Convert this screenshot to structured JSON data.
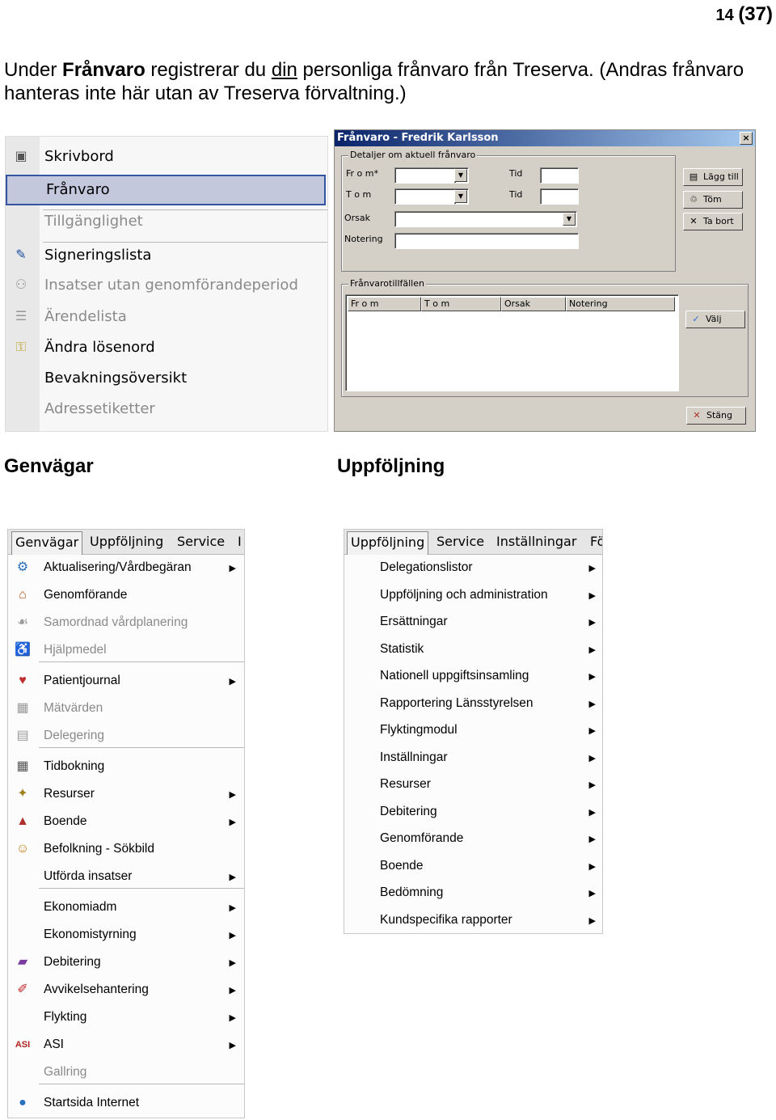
{
  "page": {
    "number": "14",
    "total": "(37)"
  },
  "intro": {
    "part1": "Under ",
    "bold": "Frånvaro",
    "part2": " registrerar du ",
    "underlined": "din",
    "part3": " personliga frånvaro från Treserva. (Andras frånvaro hanteras inte här utan av Treserva förvaltning.)"
  },
  "shortcut_menu": {
    "items": [
      {
        "label": "Skrivbord",
        "icon": "desktop-icon",
        "disabled": false
      },
      {
        "label": "Frånvaro",
        "icon": "",
        "disabled": false,
        "selected": true
      },
      {
        "label": "Tillgänglighet",
        "icon": "",
        "disabled": true
      },
      {
        "label": "Signeringslista",
        "icon": "signing-icon",
        "disabled": false
      },
      {
        "label": "Insatser utan genomförandeperiod",
        "icon": "people-icon",
        "disabled": true
      },
      {
        "label": "Ärendelista",
        "icon": "list-icon",
        "disabled": true
      },
      {
        "label": "Ändra lösenord",
        "icon": "key-icon",
        "disabled": false
      },
      {
        "label": "Bevakningsöversikt",
        "icon": "",
        "disabled": false
      },
      {
        "label": "Adressetiketter",
        "icon": "",
        "disabled": true
      }
    ]
  },
  "dialog": {
    "title": "Frånvaro - Fredrik Karlsson",
    "close": "×",
    "details_group": "Detaljer om aktuell frånvaro",
    "from_label": "Fr o m*",
    "tom_label": "T o m",
    "tid_label": "Tid",
    "orsak_label": "Orsak",
    "notering_label": "Notering",
    "add_button": "Lägg till",
    "clear_button": "Töm",
    "delete_button": "Ta bort",
    "occasions_group": "Frånvarotillfällen",
    "columns": [
      "Fr o m",
      "T o m",
      "Orsak",
      "Notering"
    ],
    "select_button": "Välj",
    "close_button": "Stäng"
  },
  "captions": {
    "left": "Genvägar",
    "right": "Uppföljning"
  },
  "genvagar_menubar": [
    "Genvägar",
    "Uppföljning",
    "Service",
    "I"
  ],
  "genvagar_menu": {
    "items": [
      {
        "label": "Aktualisering/Vårdbegäran",
        "icon": "gear-icon",
        "submenu": true,
        "disabled": false
      },
      {
        "label": "Genomförande",
        "icon": "house-icon",
        "submenu": false,
        "disabled": false
      },
      {
        "label": "Samordnad vårdplanering",
        "icon": "handshake-icon",
        "submenu": false,
        "disabled": true
      },
      {
        "label": "Hjälpmedel",
        "icon": "wheelchair-icon",
        "submenu": false,
        "disabled": true
      },
      {
        "label": "Patientjournal",
        "icon": "heart-icon",
        "submenu": true,
        "disabled": false
      },
      {
        "label": "Mätvärden",
        "icon": "chart-icon",
        "submenu": false,
        "disabled": true
      },
      {
        "label": "Delegering",
        "icon": "document-icon",
        "submenu": false,
        "disabled": true
      },
      {
        "label": "Tidbokning",
        "icon": "calendar-icon",
        "submenu": false,
        "disabled": false
      },
      {
        "label": "Resurser",
        "icon": "wand-icon",
        "submenu": true,
        "disabled": false
      },
      {
        "label": "Boende",
        "icon": "building-icon",
        "submenu": true,
        "disabled": false
      },
      {
        "label": "Befolkning - Sökbild",
        "icon": "crowd-icon",
        "submenu": false,
        "disabled": false
      },
      {
        "label": "Utförda insatser",
        "icon": "",
        "submenu": true,
        "disabled": false
      },
      {
        "label": "Ekonomiadm",
        "icon": "",
        "submenu": true,
        "disabled": false
      },
      {
        "label": "Ekonomistyrning",
        "icon": "",
        "submenu": true,
        "disabled": false
      },
      {
        "label": "Debitering",
        "icon": "book-icon",
        "submenu": true,
        "disabled": false
      },
      {
        "label": "Avvikelsehantering",
        "icon": "pen-icon",
        "submenu": true,
        "disabled": false
      },
      {
        "label": "Flykting",
        "icon": "",
        "submenu": true,
        "disabled": false
      },
      {
        "label": "ASI",
        "icon": "asi-icon",
        "icon_text": "ASI",
        "submenu": true,
        "disabled": false
      },
      {
        "label": "Gallring",
        "icon": "",
        "submenu": false,
        "disabled": true
      },
      {
        "label": "Startsida Internet",
        "icon": "globe-icon",
        "submenu": false,
        "disabled": false
      }
    ]
  },
  "uppfoljning_menubar": [
    "Uppföljning",
    "Service",
    "Inställningar",
    "Fö"
  ],
  "uppfoljning_menu": {
    "items": [
      {
        "label": "Delegationslistor",
        "submenu": true
      },
      {
        "label": "Uppföljning och administration",
        "submenu": true
      },
      {
        "label": "Ersättningar",
        "submenu": true
      },
      {
        "label": "Statistik",
        "submenu": true
      },
      {
        "label": "Nationell uppgiftsinsamling",
        "submenu": true
      },
      {
        "label": "Rapportering Länsstyrelsen",
        "submenu": true
      },
      {
        "label": "Flyktingmodul",
        "submenu": true
      },
      {
        "label": "Inställningar",
        "submenu": true
      },
      {
        "label": "Resurser",
        "submenu": true
      },
      {
        "label": "Debitering",
        "submenu": true
      },
      {
        "label": "Genomförande",
        "submenu": true
      },
      {
        "label": "Boende",
        "submenu": true
      },
      {
        "label": "Bedömning",
        "submenu": true
      },
      {
        "label": "Kundspecifika rapporter",
        "submenu": true
      }
    ]
  }
}
